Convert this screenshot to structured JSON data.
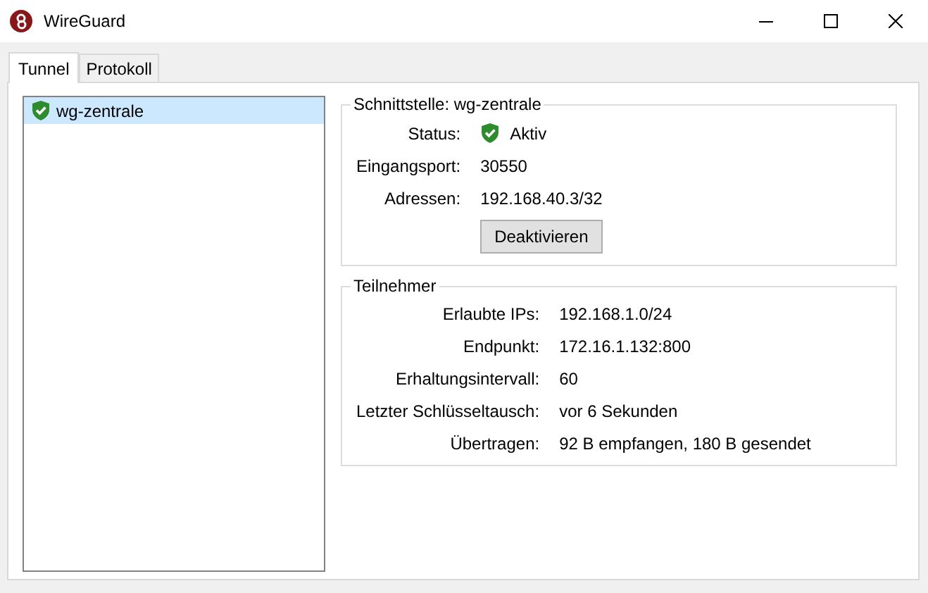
{
  "window": {
    "title": "WireGuard"
  },
  "tabs": [
    {
      "label": "Tunnel",
      "selected": true
    },
    {
      "label": "Protokoll",
      "selected": false
    }
  ],
  "tunnels": [
    {
      "name": "wg-zentrale",
      "active": true,
      "selected": true
    }
  ],
  "interface": {
    "title": "Schnittstelle: wg-zentrale",
    "rows": [
      {
        "label": "Status:",
        "value": "Aktiv",
        "kind": "status",
        "active": true
      },
      {
        "label": "Eingangsport:",
        "value": "30550",
        "kind": "text"
      },
      {
        "label": "Adressen:",
        "value": "192.168.40.3/32",
        "kind": "text"
      }
    ],
    "button": "Deaktivieren"
  },
  "peer": {
    "title": "Teilnehmer",
    "rows": [
      {
        "label": "Erlaubte IPs:",
        "value": "192.168.1.0/24",
        "kind": "text"
      },
      {
        "label": "Endpunkt:",
        "value": "172.16.1.132:800",
        "kind": "text"
      },
      {
        "label": "Erhaltungsintervall:",
        "value": "60",
        "kind": "text"
      },
      {
        "label": "Letzter Schlüsseltausch:",
        "value": "vor 6 Sekunden",
        "kind": "text"
      },
      {
        "label": "Übertragen:",
        "value": "92 B empfangen, 180 B gesendet",
        "kind": "text"
      }
    ]
  }
}
